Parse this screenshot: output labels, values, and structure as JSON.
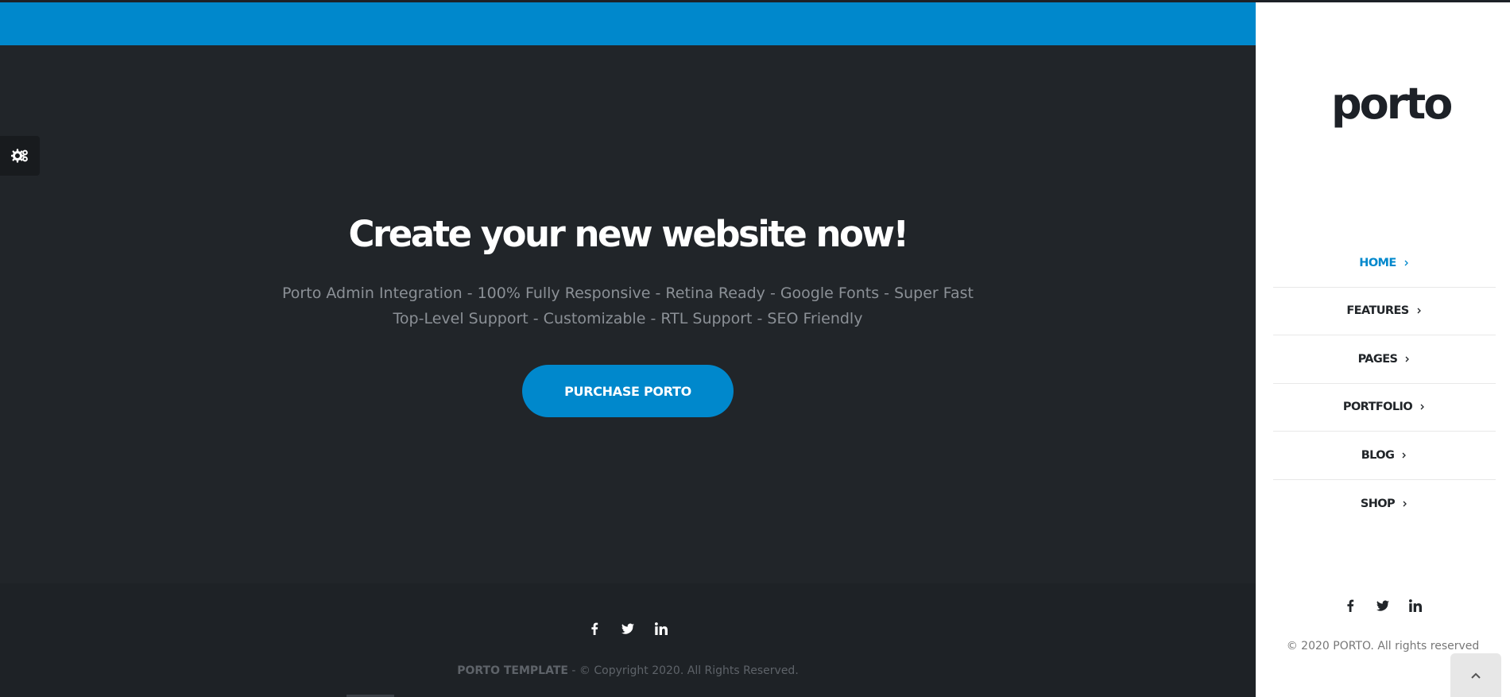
{
  "hero": {
    "title": "Create your new website now!",
    "line1": "Porto Admin Integration - 100% Fully Responsive - Retina Ready - Google Fonts - Super Fast",
    "line2": "Top-Level Support - Customizable - RTL Support - SEO Friendly",
    "cta_label": "PURCHASE PORTO"
  },
  "footer": {
    "brand": "PORTO TEMPLATE",
    "copyright": " - © Copyright 2020. All Rights Reserved.",
    "social_icons": [
      "facebook-icon",
      "twitter-icon",
      "linkedin-icon"
    ]
  },
  "sidebar": {
    "logo_text": "porto",
    "nav": [
      {
        "label": "HOME",
        "active": true
      },
      {
        "label": "FEATURES",
        "active": false
      },
      {
        "label": "PAGES",
        "active": false
      },
      {
        "label": "PORTFOLIO",
        "active": false
      },
      {
        "label": "BLOG",
        "active": false
      },
      {
        "label": "SHOP",
        "active": false
      }
    ],
    "copyright": "© 2020 PORTO. All rights reserved",
    "social_icons": [
      "facebook-icon",
      "twitter-icon",
      "linkedin-icon"
    ]
  },
  "colors": {
    "accent": "#0088cc",
    "dark_bg": "#212529",
    "footer_bg": "#1e2226"
  },
  "icons": {
    "settings": "gears-icon",
    "back_to_top": "chevron-up-icon",
    "nav_chevron": "chevron-right-icon"
  }
}
